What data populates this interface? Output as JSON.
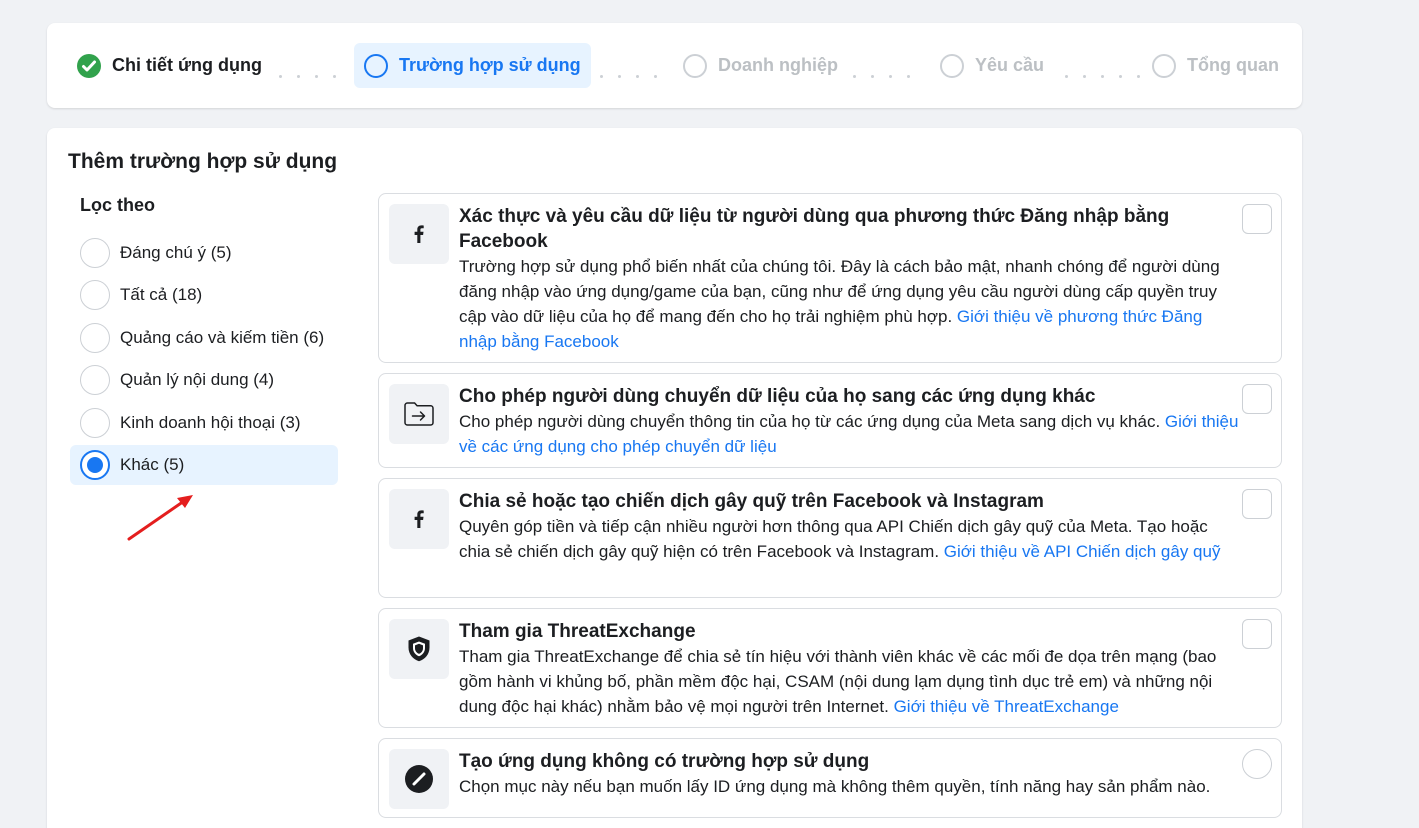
{
  "stepper": {
    "steps": [
      {
        "label": "Chi tiết ứng dụng",
        "state": "done"
      },
      {
        "label": "Trường hợp sử dụng",
        "state": "current"
      },
      {
        "label": "Doanh nghiệp",
        "state": "pending"
      },
      {
        "label": "Yêu cầu",
        "state": "pending"
      },
      {
        "label": "Tổng quan",
        "state": "pending"
      }
    ]
  },
  "main": {
    "title": "Thêm trường hợp sử dụng",
    "filter": {
      "title": "Lọc theo",
      "options": [
        {
          "label": "Đáng chú ý (5)",
          "selected": false
        },
        {
          "label": "Tất cả (18)",
          "selected": false
        },
        {
          "label": "Quảng cáo và kiếm tiền (6)",
          "selected": false
        },
        {
          "label": "Quản lý nội dung (4)",
          "selected": false
        },
        {
          "label": "Kinh doanh hội thoại (3)",
          "selected": false
        },
        {
          "label": "Khác (5)",
          "selected": true
        }
      ]
    },
    "use_cases": [
      {
        "icon": "facebook-icon",
        "title": "Xác thực và yêu cầu dữ liệu từ người dùng qua phương thức Đăng nhập bằng Facebook",
        "description": "Trường hợp sử dụng phổ biến nhất của chúng tôi. Đây là cách bảo mật, nhanh chóng để người dùng đăng nhập vào ứng dụng/game của bạn, cũng như để ứng dụng yêu cầu người dùng cấp quyền truy cập vào dữ liệu của họ để mang đến cho họ trải nghiệm phù hợp. ",
        "link": "Giới thiệu về phương thức Đăng nhập bằng Facebook"
      },
      {
        "icon": "folder-transfer-icon",
        "title": "Cho phép người dùng chuyển dữ liệu của họ sang các ứng dụng khác",
        "description": "Cho phép người dùng chuyển thông tin của họ từ các ứng dụng của Meta sang dịch vụ khác. ",
        "link": "Giới thiệu về các ứng dụng cho phép chuyển dữ liệu"
      },
      {
        "icon": "facebook-icon",
        "title": "Chia sẻ hoặc tạo chiến dịch gây quỹ trên Facebook và Instagram",
        "description": "Quyên góp tiền và tiếp cận nhiều người hơn thông qua API Chiến dịch gây quỹ của Meta. Tạo hoặc chia sẻ chiến dịch gây quỹ hiện có trên Facebook và Instagram. ",
        "link": "Giới thiệu về API Chiến dịch gây quỹ"
      },
      {
        "icon": "shield-icon",
        "title": "Tham gia ThreatExchange",
        "description": "Tham gia ThreatExchange để chia sẻ tín hiệu với thành viên khác về các mối đe dọa trên mạng (bao gồm hành vi khủng bố, phần mềm độc hại, CSAM (nội dung lạm dụng tình dục trẻ em) và những nội dung độc hại khác) nhằm bảo vệ mọi người trên Internet. ",
        "link": "Giới thiệu về ThreatExchange"
      },
      {
        "icon": "block-icon",
        "title": "Tạo ứng dụng không có trường hợp sử dụng",
        "description": "Chọn mục này nếu bạn muốn lấy ID ứng dụng mà không thêm quyền, tính năng hay sản phẩm nào.",
        "link": ""
      }
    ]
  },
  "colors": {
    "accent": "#1877f2",
    "success": "#31a24c",
    "annotation": "#e41e1e"
  }
}
